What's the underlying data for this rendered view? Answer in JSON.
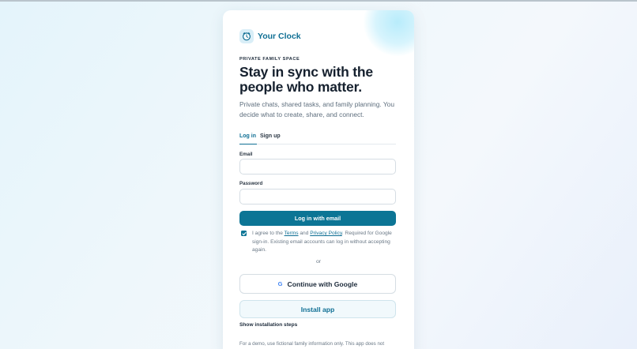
{
  "brand": {
    "name": "Your Clock",
    "icon": "clock-icon"
  },
  "hero": {
    "eyebrow": "PRIVATE FAMILY SPACE",
    "headline": "Stay in sync with the people who matter.",
    "subtitle": "Private chats, shared tasks, and family planning. You decide what to create, share, and connect."
  },
  "tabs": [
    {
      "label": "Log in",
      "active": true
    },
    {
      "label": "Sign up",
      "active": false
    }
  ],
  "form": {
    "email_label": "Email",
    "email_value": "",
    "email_placeholder": "",
    "password_label": "Password",
    "password_value": "",
    "password_placeholder": "",
    "submit_label": "Log in with email"
  },
  "consent": {
    "checked": true,
    "prefix": "I agree to the ",
    "terms_label": "Terms",
    "middle": " and ",
    "privacy_label": "Privacy Policy",
    "suffix": ". Required for Google sign-in. Existing email accounts can log in without accepting again."
  },
  "divider_text": "or",
  "google": {
    "label": "Continue with Google",
    "icon": "google-icon"
  },
  "install": {
    "label": "Install app",
    "steps_label": "Show installation steps"
  },
  "footer": {
    "disclaimer": "For a demo, use fictional family information only. This app does not"
  },
  "colors": {
    "accent": "#0c7595",
    "brand_text": "#0f6f94",
    "headline": "#15202e",
    "muted_text": "#5e6e7d"
  }
}
